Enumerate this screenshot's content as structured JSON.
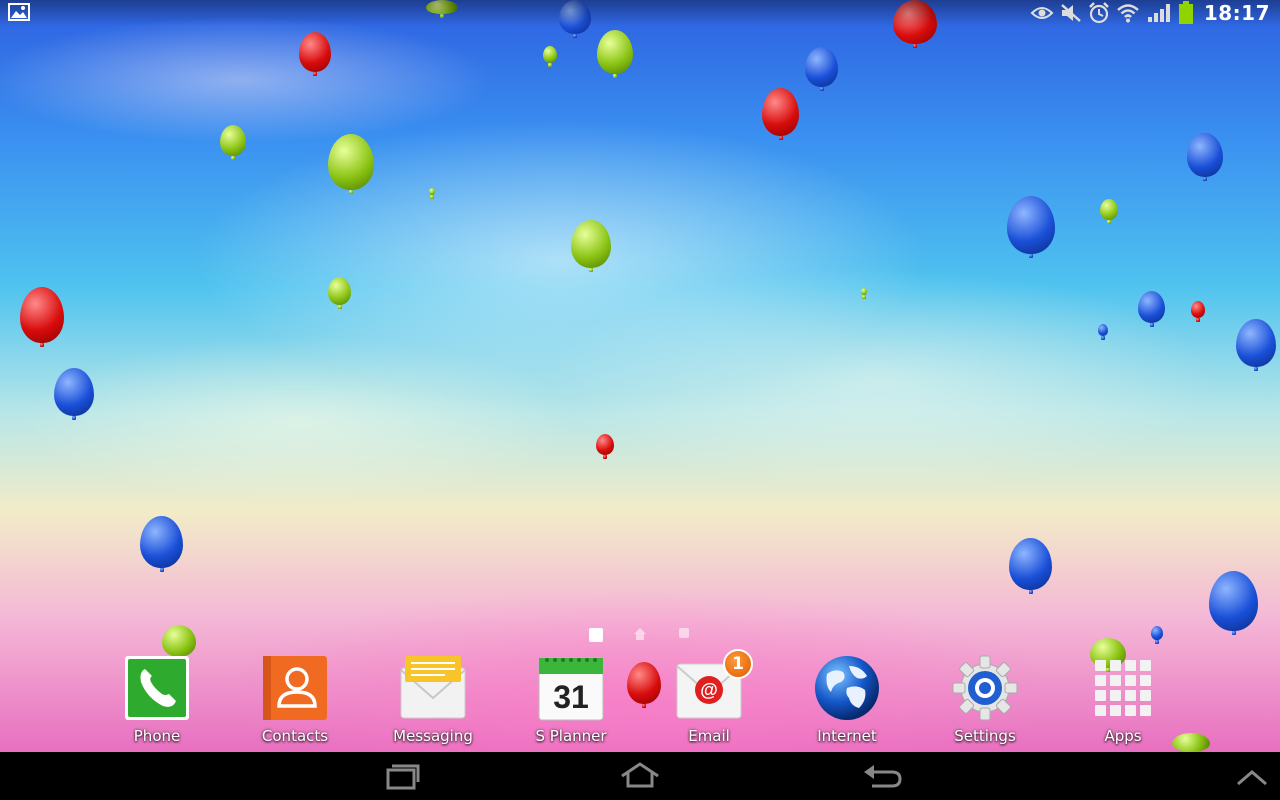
{
  "status_bar": {
    "time": "18:17",
    "left_icon": "gallery-icon",
    "icons": [
      "smart-stay-eye-icon",
      "mute-icon",
      "alarm-icon",
      "wifi-icon",
      "signal-icon",
      "battery-icon"
    ]
  },
  "home_screen": {
    "page_count": 3,
    "current_page": 1,
    "home_page_marker": 2
  },
  "dock": {
    "items": [
      {
        "label": "Phone",
        "icon": "phone-icon"
      },
      {
        "label": "Contacts",
        "icon": "contacts-icon"
      },
      {
        "label": "Messaging",
        "icon": "messaging-icon"
      },
      {
        "label": "S Planner",
        "icon": "calendar-icon",
        "icon_text": "31"
      },
      {
        "label": "Email",
        "icon": "email-icon",
        "badge": "1"
      },
      {
        "label": "Internet",
        "icon": "globe-icon"
      },
      {
        "label": "Settings",
        "icon": "gear-icon"
      },
      {
        "label": "Apps",
        "icon": "apps-grid-icon"
      }
    ]
  },
  "nav_bar": {
    "buttons": [
      "recent-apps-icon",
      "home-icon",
      "back-icon",
      "chevron-up-icon"
    ]
  },
  "colors": {
    "phone": "#2eaa2e",
    "contacts": "#f06a22",
    "messaging": "#f7c52a",
    "calendar": "#3bb53b",
    "email_badge": "#f07a10",
    "settings": "#1f5fd0"
  }
}
